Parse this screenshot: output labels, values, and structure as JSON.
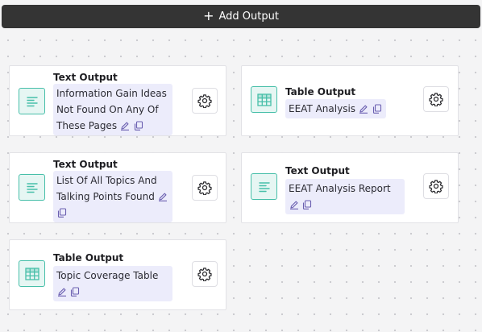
{
  "header": {
    "add_output_label": "Add Output",
    "plus_symbol": "+"
  },
  "cards": [
    {
      "type": "text",
      "icon": "text-lines-icon",
      "title": "Text Output",
      "name": "Information Gain Ideas Not Found On Any Of These Pages"
    },
    {
      "type": "table",
      "icon": "table-grid-icon",
      "title": "Table Output",
      "name": "EEAT Analysis"
    },
    {
      "type": "text",
      "icon": "text-lines-icon",
      "title": "Text Output",
      "name": "List Of All Topics And Talking Points Found"
    },
    {
      "type": "text",
      "icon": "text-lines-icon",
      "title": "Text Output",
      "name": "EEAT Analysis Report"
    },
    {
      "type": "table",
      "icon": "table-grid-icon",
      "title": "Table Output",
      "name": "Topic Coverage Table"
    }
  ],
  "colors": {
    "accent": "#47bfa9",
    "name_bg": "#ececfb",
    "icon_purple": "#6a5fb0",
    "bar": "#343434"
  }
}
